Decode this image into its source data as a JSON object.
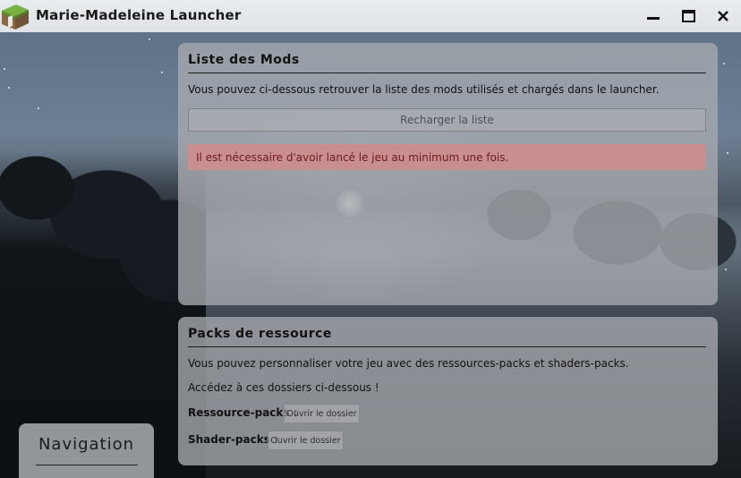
{
  "window": {
    "title": "Marie-Madeleine Launcher",
    "logo_icon": "grass-block-icon",
    "controls": {
      "minimize_icon": "minimize-icon",
      "maximize_icon": "maximize-icon",
      "close_icon": "close-icon"
    }
  },
  "mods_panel": {
    "title": "Liste des Mods",
    "description": "Vous pouvez ci-dessous retrouver la liste des mods utilisés et chargés dans le launcher.",
    "reload_button": "Recharger la liste",
    "alert": "Il est nécessaire d'avoir lancé le jeu au minimum une fois."
  },
  "packs_panel": {
    "title": "Packs de ressource",
    "description": "Vous pouvez personnaliser votre jeu avec des ressources-packs et shaders-packs.",
    "access_text": "Accédez à ces dossiers ci-dessous !",
    "resource_label": "Ressource-packs :",
    "resource_button": "Ouvrir le dossier",
    "shader_label": "Shader-packs :",
    "shader_button": "Ouvrir le dossier"
  },
  "navigation": {
    "label": "Navigation"
  },
  "colors": {
    "alert_background": "#c98e90",
    "alert_text": "#6e1a1c",
    "titlebar": "#e4e7ea"
  }
}
